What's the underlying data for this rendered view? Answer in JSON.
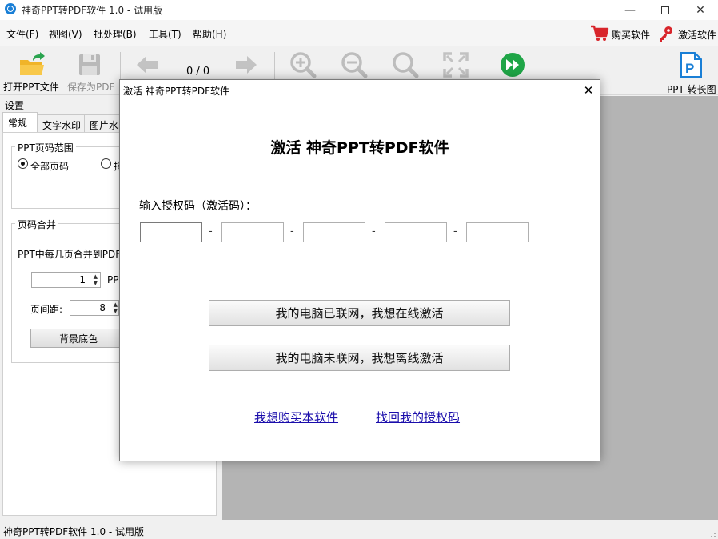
{
  "window": {
    "title": "神奇PPT转PDF软件 1.0 - 试用版",
    "minimize_glyph": "—",
    "maximize_glyph": "☐",
    "close_glyph": "✕"
  },
  "menu": {
    "items": [
      "文件(F)",
      "视图(V)",
      "批处理(B)",
      "工具(T)",
      "帮助(H)"
    ],
    "buy_label": "购买软件",
    "activate_label": "激活软件"
  },
  "toolbar": {
    "open_label": "打开PPT文件",
    "save_label": "保存为PDF",
    "page_counter": "0 / 0",
    "long_image_label": "PPT 转长图"
  },
  "settings": {
    "title": "设置",
    "tabs": [
      "常规",
      "文字水印",
      "图片水印"
    ],
    "range_group": "PPT页码范围",
    "radio_all": "全部页码",
    "radio_other": "指",
    "merge_group": "页码合并",
    "merge_desc": "PPT中每几页合并到PDF",
    "merge_value": "1",
    "merge_unit": "PP",
    "spacing_label": "页间距:",
    "spacing_value": "8",
    "bg_button": "背景底色"
  },
  "status": {
    "text": "神奇PPT转PDF软件 1.0 - 试用版"
  },
  "dialog": {
    "title": "激活 神奇PPT转PDF软件",
    "close_glyph": "✕",
    "heading": "激活 神奇PPT转PDF软件",
    "code_label": "输入授权码（激活码）：",
    "code_values": [
      "",
      "",
      "",
      "",
      ""
    ],
    "dash": "-",
    "online_button": "我的电脑已联网，我想在线激活",
    "offline_button": "我的电脑未联网，我想离线激活",
    "buy_link": "我想购买本软件",
    "recover_link": "找回我的授权码"
  },
  "colors": {
    "accent": "#1a7fd6",
    "link": "#1a0dab",
    "cart_red": "#d8252b",
    "green": "#1fa547"
  }
}
